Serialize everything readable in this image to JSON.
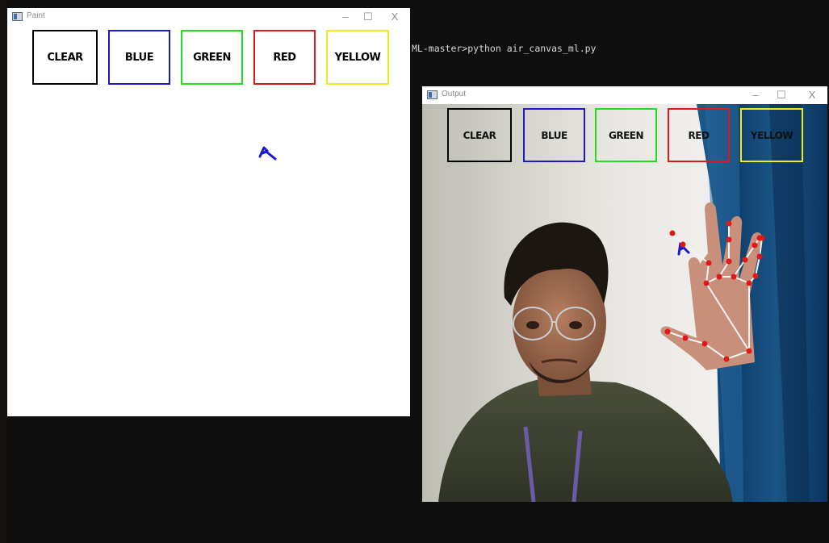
{
  "console": {
    "command_line": "ML-master>python air_canvas_ml.py"
  },
  "paint_window": {
    "title": "Paint",
    "controls": {
      "minimize": "–",
      "maximize": "☐",
      "close": "X"
    },
    "buttons": [
      {
        "label": "CLEAR",
        "color": "#000000"
      },
      {
        "label": "BLUE",
        "color": "#1a1acc"
      },
      {
        "label": "GREEN",
        "color": "#22dd22"
      },
      {
        "label": "RED",
        "color": "#dd1a1a"
      },
      {
        "label": "YELLOW",
        "color": "#f2ea1e"
      }
    ],
    "stroke_color": "#1a1acc"
  },
  "output_window": {
    "title": "Output",
    "controls": {
      "minimize": "–",
      "maximize": "☐",
      "close": "X"
    },
    "buttons": [
      {
        "label": "CLEAR",
        "color": "#000000"
      },
      {
        "label": "BLUE",
        "color": "#1a1acc"
      },
      {
        "label": "GREEN",
        "color": "#22dd22"
      },
      {
        "label": "RED",
        "color": "#dd1a1a"
      },
      {
        "label": "YELLOW",
        "color": "#f2ea1e"
      }
    ],
    "landmark_color": "#e01818",
    "connection_color": "#f4f4f4"
  }
}
